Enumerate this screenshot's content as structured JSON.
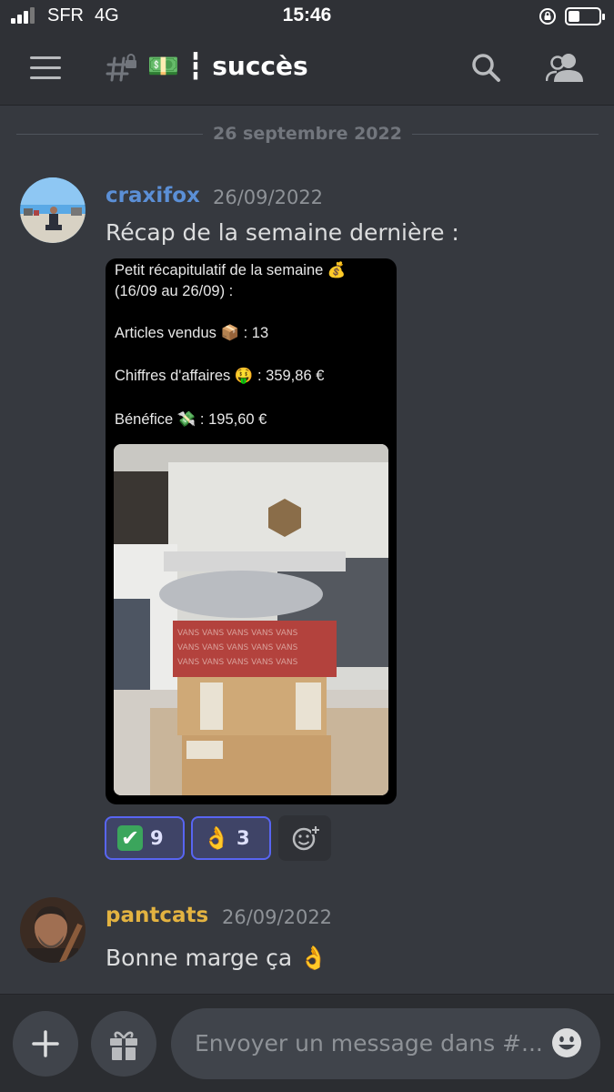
{
  "status_bar": {
    "carrier": "SFR",
    "network": "4G",
    "time": "15:46"
  },
  "header": {
    "channel_name": "💵 ┇ succès",
    "menu_icon": "hamburger-icon",
    "channel_icon": "locked-hash-icon",
    "search_icon": "search-icon",
    "members_icon": "members-icon"
  },
  "date_divider": "26 septembre 2022",
  "messages": [
    {
      "username": "craxifox",
      "username_color": "#5b8fd6",
      "timestamp": "26/09/2022",
      "text": "Récap de la semaine dernière :",
      "attachment": {
        "line1": "Petit récapitulatif de la semaine 💰",
        "line2": "(16/09 au 26/09) :",
        "line3": "Articles vendus 📦 : 13",
        "line4": "Chiffres d'affaires 🤑 : 359,86 €",
        "line5": "Bénéfice 💸 : 195,60 €"
      },
      "reactions": [
        {
          "emoji": "✔",
          "count": "9"
        },
        {
          "emoji": "👌",
          "count": "3"
        }
      ]
    },
    {
      "username": "pantcats",
      "username_color": "#e3b341",
      "timestamp": "26/09/2022",
      "text": "Bonne marge ça 👌"
    }
  ],
  "composer": {
    "placeholder": "Envoyer un message dans #..."
  },
  "colors": {
    "accent": "#5865f2",
    "background": "#36393f",
    "header": "#2f3136"
  }
}
